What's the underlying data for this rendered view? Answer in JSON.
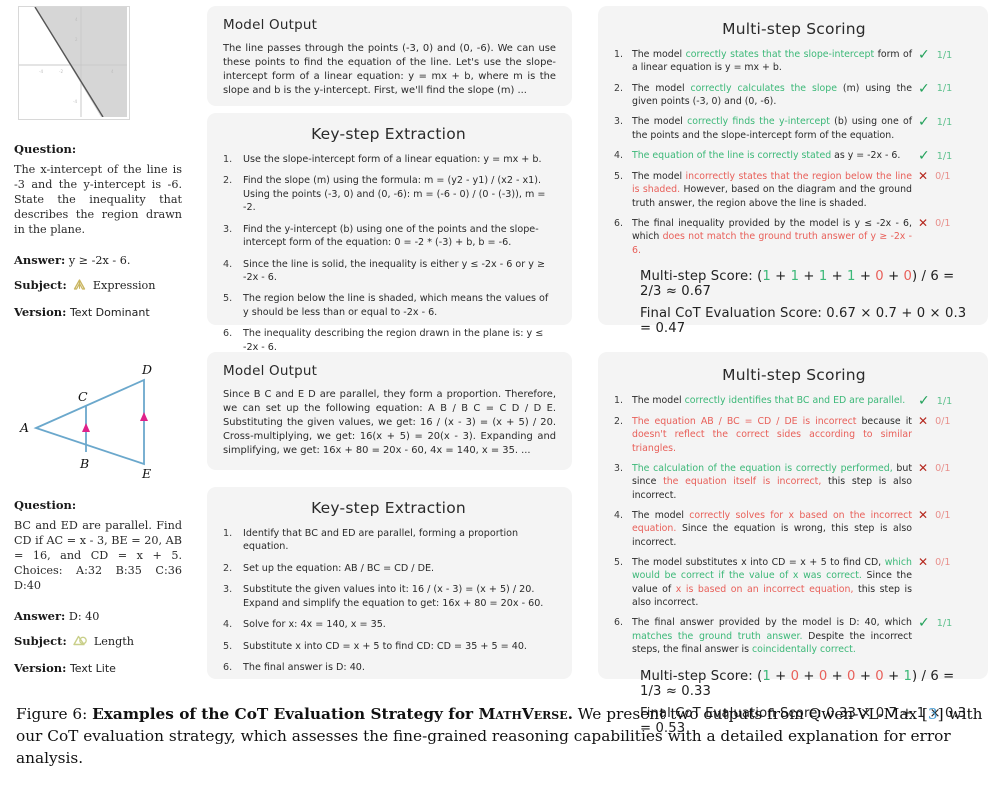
{
  "examples": [
    {
      "figure": {
        "type": "inequality-graph",
        "description": "Cartesian plane with solid line and shaded region above the line"
      },
      "question": {
        "label": "Question:",
        "text": "The x-intercept of the line is -3 and the y-intercept is -6. State the inequality that describes the region drawn in the plane."
      },
      "answer": {
        "label": "Answer:",
        "value": "y ≥ -2x - 6."
      },
      "subject": {
        "label": "Subject:",
        "value": "Expression",
        "icon": "expression-icon",
        "icon_color": "#c9b560"
      },
      "version": {
        "label": "Version:",
        "value": "Text Dominant"
      },
      "model_output": {
        "title": "Model Output",
        "text": "The line passes through the points (-3, 0) and (0, -6). We can use these points to find the equation of the line. Let's use the slope-intercept form of a linear equation: y = mx + b, where m is the slope and b is the y-intercept. First, we'll find the slope (m) ..."
      },
      "key_step_extraction": {
        "title": "Key-step Extraction",
        "steps": [
          "Use the slope-intercept form of a linear equation: y = mx + b.",
          "Find the slope (m) using the formula: m = (y2 - y1) / (x2 - x1). Using the points (-3, 0) and (0, -6): m = (-6 - 0) / (0 - (-3)), m = -2.",
          "Find the y-intercept (b) using one of the points and the slope-intercept form of the equation: 0 = -2 * (-3) + b, b = -6.",
          "Since the line is solid, the inequality is either y ≤ -2x - 6 or y ≥ -2x - 6.",
          "The region below the line is shaded, which means the values of y should be less than or equal to -2x - 6.",
          "The inequality describing the region drawn in the plane is: y ≤ -2x - 6."
        ]
      },
      "multi_step_scoring": {
        "title": "Multi-step Scoring",
        "items": [
          {
            "num": "1.",
            "mark": "check",
            "score": "1/1",
            "parts": [
              {
                "t": "The model ",
                "c": "n"
              },
              {
                "t": "correctly states that the slope-intercept ",
                "c": "g"
              },
              {
                "t": "form of a linear equation is y = mx + b.",
                "c": "n"
              }
            ]
          },
          {
            "num": "2.",
            "mark": "check",
            "score": "1/1",
            "parts": [
              {
                "t": "The model ",
                "c": "n"
              },
              {
                "t": "correctly calculates the slope ",
                "c": "g"
              },
              {
                "t": "(m) using the given points (-3, 0) and (0, -6).",
                "c": "n"
              }
            ]
          },
          {
            "num": "3.",
            "mark": "check",
            "score": "1/1",
            "parts": [
              {
                "t": "The model ",
                "c": "n"
              },
              {
                "t": "correctly finds the y-intercept ",
                "c": "g"
              },
              {
                "t": "(b) using one of the points and the slope-intercept form of the equation.",
                "c": "n"
              }
            ]
          },
          {
            "num": "4.",
            "mark": "check",
            "score": "1/1",
            "parts": [
              {
                "t": "The equation of the line is correctly stated ",
                "c": "g"
              },
              {
                "t": "as y = -2x - 6.",
                "c": "n"
              }
            ]
          },
          {
            "num": "5.",
            "mark": "cross",
            "score": "0/1",
            "parts": [
              {
                "t": "The model ",
                "c": "n"
              },
              {
                "t": "incorrectly states that the region below the line is shaded. ",
                "c": "r"
              },
              {
                "t": "However, based on the diagram and the ground truth answer, the region above the line is shaded.",
                "c": "n"
              }
            ]
          },
          {
            "num": "6.",
            "mark": "cross",
            "score": "0/1",
            "parts": [
              {
                "t": "The final inequality provided by the model is y ≤ -2x - 6, which ",
                "c": "n"
              },
              {
                "t": "does not match the ground truth answer of y ≥ -2x - 6.",
                "c": "r"
              }
            ]
          }
        ],
        "multi_step_score": {
          "label": "Multi-step Score:",
          "terms": [
            "1",
            "1",
            "1",
            "1",
            "0",
            "0"
          ],
          "term_colors": [
            "g",
            "g",
            "g",
            "g",
            "r",
            "r"
          ],
          "tail": ") / 6 = 2/3 ≈ 0.67"
        },
        "final_score": {
          "label": "Final CoT Evaluation Score:",
          "value": "0.67 × 0.7 + 0 × 0.3 = 0.47"
        }
      }
    },
    {
      "figure": {
        "type": "triangle-diagram",
        "description": "Triangle A-D-E with segment BC parallel to ED, tick arrows marking parallel sides",
        "vertices": [
          "A",
          "B",
          "C",
          "D",
          "E"
        ],
        "line_color": "#6ba8cc",
        "mark_color": "#e0218a"
      },
      "question": {
        "label": "Question:",
        "text": "BC and ED are parallel. Find CD if AC = x - 3, BE = 20, AB = 16, and CD = x + 5. Choices: A:32 B:35 C:36 D:40"
      },
      "answer": {
        "label": "Answer:",
        "value": "D: 40"
      },
      "subject": {
        "label": "Subject:",
        "value": "Length",
        "icon": "length-icon",
        "icon_color": "#c9cf8a"
      },
      "version": {
        "label": "Version:",
        "value": "Text Lite"
      },
      "model_output": {
        "title": "Model Output",
        "text": "Since B C and E D are parallel, they form a proportion. Therefore, we can set up the following equation: A B / B C = C D / D E. Substituting the given values, we get: 16 / (x - 3) = (x + 5) / 20. Cross-multiplying, we get: 16(x + 5) = 20(x - 3). Expanding and simplifying, we get: 16x + 80 = 20x - 60, 4x = 140, x = 35. ..."
      },
      "key_step_extraction": {
        "title": "Key-step Extraction",
        "steps": [
          "Identify that BC and ED are parallel, forming a proportion equation.",
          "Set up the equation: AB / BC = CD / DE.",
          "Substitute the given values into it: 16 / (x - 3) = (x + 5) / 20. Expand and simplify the equation to get: 16x + 80 = 20x - 60.",
          "Solve for x: 4x = 140, x = 35.",
          "Substitute x into CD = x + 5 to find CD: CD = 35 + 5 = 40.",
          "The final answer is D: 40."
        ]
      },
      "multi_step_scoring": {
        "title": "Multi-step Scoring",
        "items": [
          {
            "num": "1.",
            "mark": "check",
            "score": "1/1",
            "parts": [
              {
                "t": "The model ",
                "c": "n"
              },
              {
                "t": "correctly identifies that BC and ED are parallel.",
                "c": "g"
              }
            ]
          },
          {
            "num": "2.",
            "mark": "cross",
            "score": "0/1",
            "parts": [
              {
                "t": "The equation AB / BC = CD / DE is incorrect ",
                "c": "r"
              },
              {
                "t": "because it ",
                "c": "n"
              },
              {
                "t": "doesn't reflect the correct sides according to similar triangles.",
                "c": "r"
              }
            ]
          },
          {
            "num": "3.",
            "mark": "cross",
            "score": "0/1",
            "parts": [
              {
                "t": "The calculation of the equation is correctly performed, ",
                "c": "g"
              },
              {
                "t": "but since ",
                "c": "n"
              },
              {
                "t": "the equation itself is incorrect, ",
                "c": "r"
              },
              {
                "t": "this step is also incorrect.",
                "c": "n"
              }
            ]
          },
          {
            "num": "4.",
            "mark": "cross",
            "score": "0/1",
            "parts": [
              {
                "t": "The model ",
                "c": "n"
              },
              {
                "t": "correctly solves for x based on the incorrect equation. ",
                "c": "r"
              },
              {
                "t": "Since the equation is wrong, this step is also incorrect.",
                "c": "n"
              }
            ]
          },
          {
            "num": "5.",
            "mark": "cross",
            "score": "0/1",
            "parts": [
              {
                "t": "The model substitutes x into CD = x + 5 to find CD, ",
                "c": "n"
              },
              {
                "t": "which would be correct if the value of x was correct. ",
                "c": "g"
              },
              {
                "t": "Since the value of ",
                "c": "n"
              },
              {
                "t": "x is based on an incorrect equation, ",
                "c": "r"
              },
              {
                "t": "this step is also incorrect.",
                "c": "n"
              }
            ]
          },
          {
            "num": "6.",
            "mark": "check",
            "score": "1/1",
            "parts": [
              {
                "t": "The final answer provided by the model is D: 40, which ",
                "c": "n"
              },
              {
                "t": "matches the ground truth answer. ",
                "c": "g"
              },
              {
                "t": "Despite the incorrect steps, the final answer is ",
                "c": "n"
              },
              {
                "t": "coincidentally correct.",
                "c": "g"
              }
            ]
          }
        ],
        "multi_step_score": {
          "label": "Multi-step Score:",
          "terms": [
            "1",
            "0",
            "0",
            "0",
            "0",
            "1"
          ],
          "term_colors": [
            "g",
            "r",
            "r",
            "r",
            "r",
            "g"
          ],
          "tail": ") / 6 = 1/3 ≈ 0.33"
        },
        "final_score": {
          "label": "Final CoT Evaluation Score:",
          "value": "0.33 × 0.7 + 1 × 0.3 = 0.53"
        }
      }
    }
  ],
  "caption": {
    "figure_number": "Figure 6:",
    "bold_title": "Examples of the CoT Evaluation Strategy for ",
    "smallcaps_name": "MathVerse",
    "bold_period": ".",
    "body_1": " We present two outputs from Qwen-VL-Max [",
    "citation": "3",
    "body_2": "] with our CoT evaluation strategy, which assesses the fine-grained reasoning capabilities with a detailed explanation for error analysis."
  }
}
